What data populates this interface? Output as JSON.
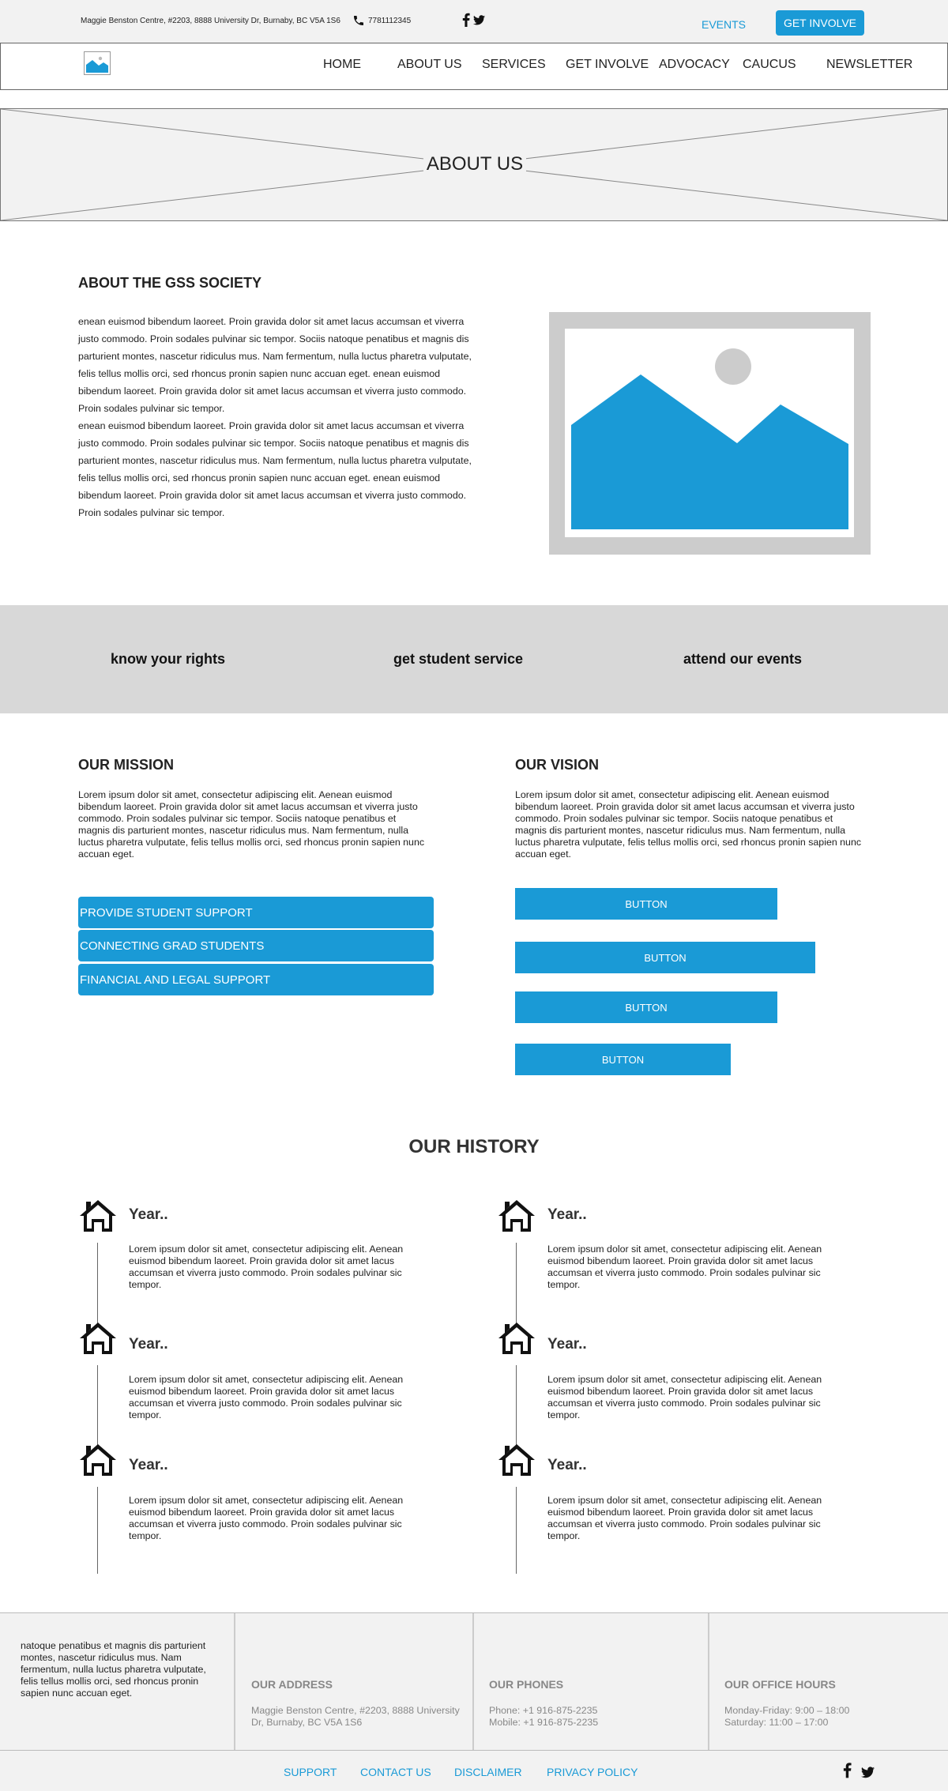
{
  "topbar": {
    "address": "Maggie Benston Centre, #2203, 8888 University Dr, Burnaby, BC V5A 1S6",
    "phone": "7781112345",
    "events": "EVENTS",
    "get_involve": "GET INVOLVE"
  },
  "nav": {
    "items": [
      "HOME",
      "ABOUT US",
      "SERVICES",
      "GET INVOLVE",
      "ADVOCACY",
      "CAUCUS",
      "NEWSLETTER"
    ]
  },
  "hero": {
    "title": "ABOUT US"
  },
  "about": {
    "heading": "ABOUT THE GSS SOCIETY",
    "text": "enean euismod bibendum laoreet. Proin gravida dolor sit amet lacus accumsan et viverra justo commodo. Proin sodales pulvinar sic tempor. Sociis natoque penatibus et magnis dis parturient montes, nascetur ridiculus mus. Nam fermentum, nulla luctus pharetra vulputate, felis tellus mollis orci, sed rhoncus pronin sapien nunc accuan eget. enean euismod bibendum laoreet. Proin gravida dolor sit amet lacus accumsan et viverra justo commodo. Proin sodales pulvinar sic tempor.\nenean euismod bibendum laoreet. Proin gravida dolor sit amet lacus accumsan et viverra justo commodo. Proin sodales pulvinar sic tempor. Sociis natoque penatibus et magnis dis parturient montes, nascetur ridiculus mus. Nam fermentum, nulla luctus pharetra vulputate, felis tellus mollis orci, sed rhoncus pronin sapien nunc accuan eget. enean euismod bibendum laoreet. Proin gravida dolor sit amet lacus accumsan et viverra justo commodo. Proin sodales pulvinar sic tempor."
  },
  "features": [
    "know your rights",
    "get student service",
    "attend our events"
  ],
  "mission": {
    "heading": "OUR MISSION",
    "text": "Lorem ipsum dolor sit amet, consectetur adipiscing elit. Aenean euismod bibendum laoreet. Proin gravida dolor sit amet lacus accumsan et viverra justo commodo. Proin sodales pulvinar sic tempor. Sociis natoque penatibus et magnis dis parturient montes, nascetur ridiculus mus. Nam fermentum, nulla luctus pharetra vulputate, felis tellus mollis orci, sed rhoncus pronin sapien nunc accuan eget.",
    "buttons": [
      "PROVIDE STUDENT SUPPORT",
      "CONNECTING GRAD STUDENTS",
      "FINANCIAL AND LEGAL SUPPORT"
    ]
  },
  "vision": {
    "heading": "OUR VISION",
    "text": "Lorem ipsum dolor sit amet, consectetur adipiscing elit. Aenean euismod bibendum laoreet. Proin gravida dolor sit amet lacus accumsan et viverra justo commodo. Proin sodales pulvinar sic tempor. Sociis natoque penatibus et magnis dis parturient montes, nascetur ridiculus mus. Nam fermentum, nulla luctus pharetra vulputate, felis tellus mollis orci, sed rhoncus pronin sapien nunc accuan eget.",
    "buttons": [
      "BUTTON",
      "BUTTON",
      "BUTTON",
      "BUTTON"
    ]
  },
  "history": {
    "title": "OUR HISTORY",
    "entries": [
      {
        "year": "Year..",
        "text": "Lorem ipsum dolor sit amet, consectetur adipiscing elit. Aenean euismod bibendum laoreet. Proin gravida dolor sit amet lacus accumsan et viverra justo commodo. Proin sodales pulvinar sic tempor."
      },
      {
        "year": "Year..",
        "text": "Lorem ipsum dolor sit amet, consectetur adipiscing elit. Aenean euismod bibendum laoreet. Proin gravida dolor sit amet lacus accumsan et viverra justo commodo. Proin sodales pulvinar sic tempor."
      },
      {
        "year": "Year..",
        "text": "Lorem ipsum dolor sit amet, consectetur adipiscing elit. Aenean euismod bibendum laoreet. Proin gravida dolor sit amet lacus accumsan et viverra justo commodo. Proin sodales pulvinar sic tempor."
      },
      {
        "year": "Year..",
        "text": "Lorem ipsum dolor sit amet, consectetur adipiscing elit. Aenean euismod bibendum laoreet. Proin gravida dolor sit amet lacus accumsan et viverra justo commodo. Proin sodales pulvinar sic tempor."
      },
      {
        "year": "Year..",
        "text": "Lorem ipsum dolor sit amet, consectetur adipiscing elit. Aenean euismod bibendum laoreet. Proin gravida dolor sit amet lacus accumsan et viverra justo commodo. Proin sodales pulvinar sic tempor."
      },
      {
        "year": "Year..",
        "text": "Lorem ipsum dolor sit amet, consectetur adipiscing elit. Aenean euismod bibendum laoreet. Proin gravida dolor sit amet lacus accumsan et viverra justo commodo. Proin sodales pulvinar sic tempor."
      }
    ]
  },
  "footer": {
    "about": "natoque penatibus et magnis dis parturient montes, nascetur ridiculus mus. Nam fermentum, nulla luctus pharetra vulputate, felis tellus mollis orci, sed rhoncus pronin sapien nunc accuan eget.",
    "address_heading": "OUR ADDRESS",
    "address": "Maggie Benston Centre, #2203, 8888 University Dr, Burnaby, BC V5A 1S6",
    "phones_heading": "OUR PHONES",
    "phone": "Phone: +1 916-875-2235",
    "mobile": "Mobile: +1 916-875-2235",
    "hours_heading": "OUR OFFICE HOURS",
    "hours_weekday": "Monday-Friday: 9:00 – 18:00",
    "hours_saturday": "Saturday: 11:00 – 17:00",
    "links": [
      "SUPPORT",
      "CONTACT US",
      "DISCLAIMER",
      "PRIVACY POLICY"
    ]
  },
  "colors": {
    "accent": "#1a9ad6",
    "panel": "#f2f2f2",
    "band": "#d8d8d8"
  },
  "icons": [
    "phone-icon",
    "facebook-icon",
    "twitter-icon",
    "image-placeholder-icon",
    "house-icon"
  ]
}
